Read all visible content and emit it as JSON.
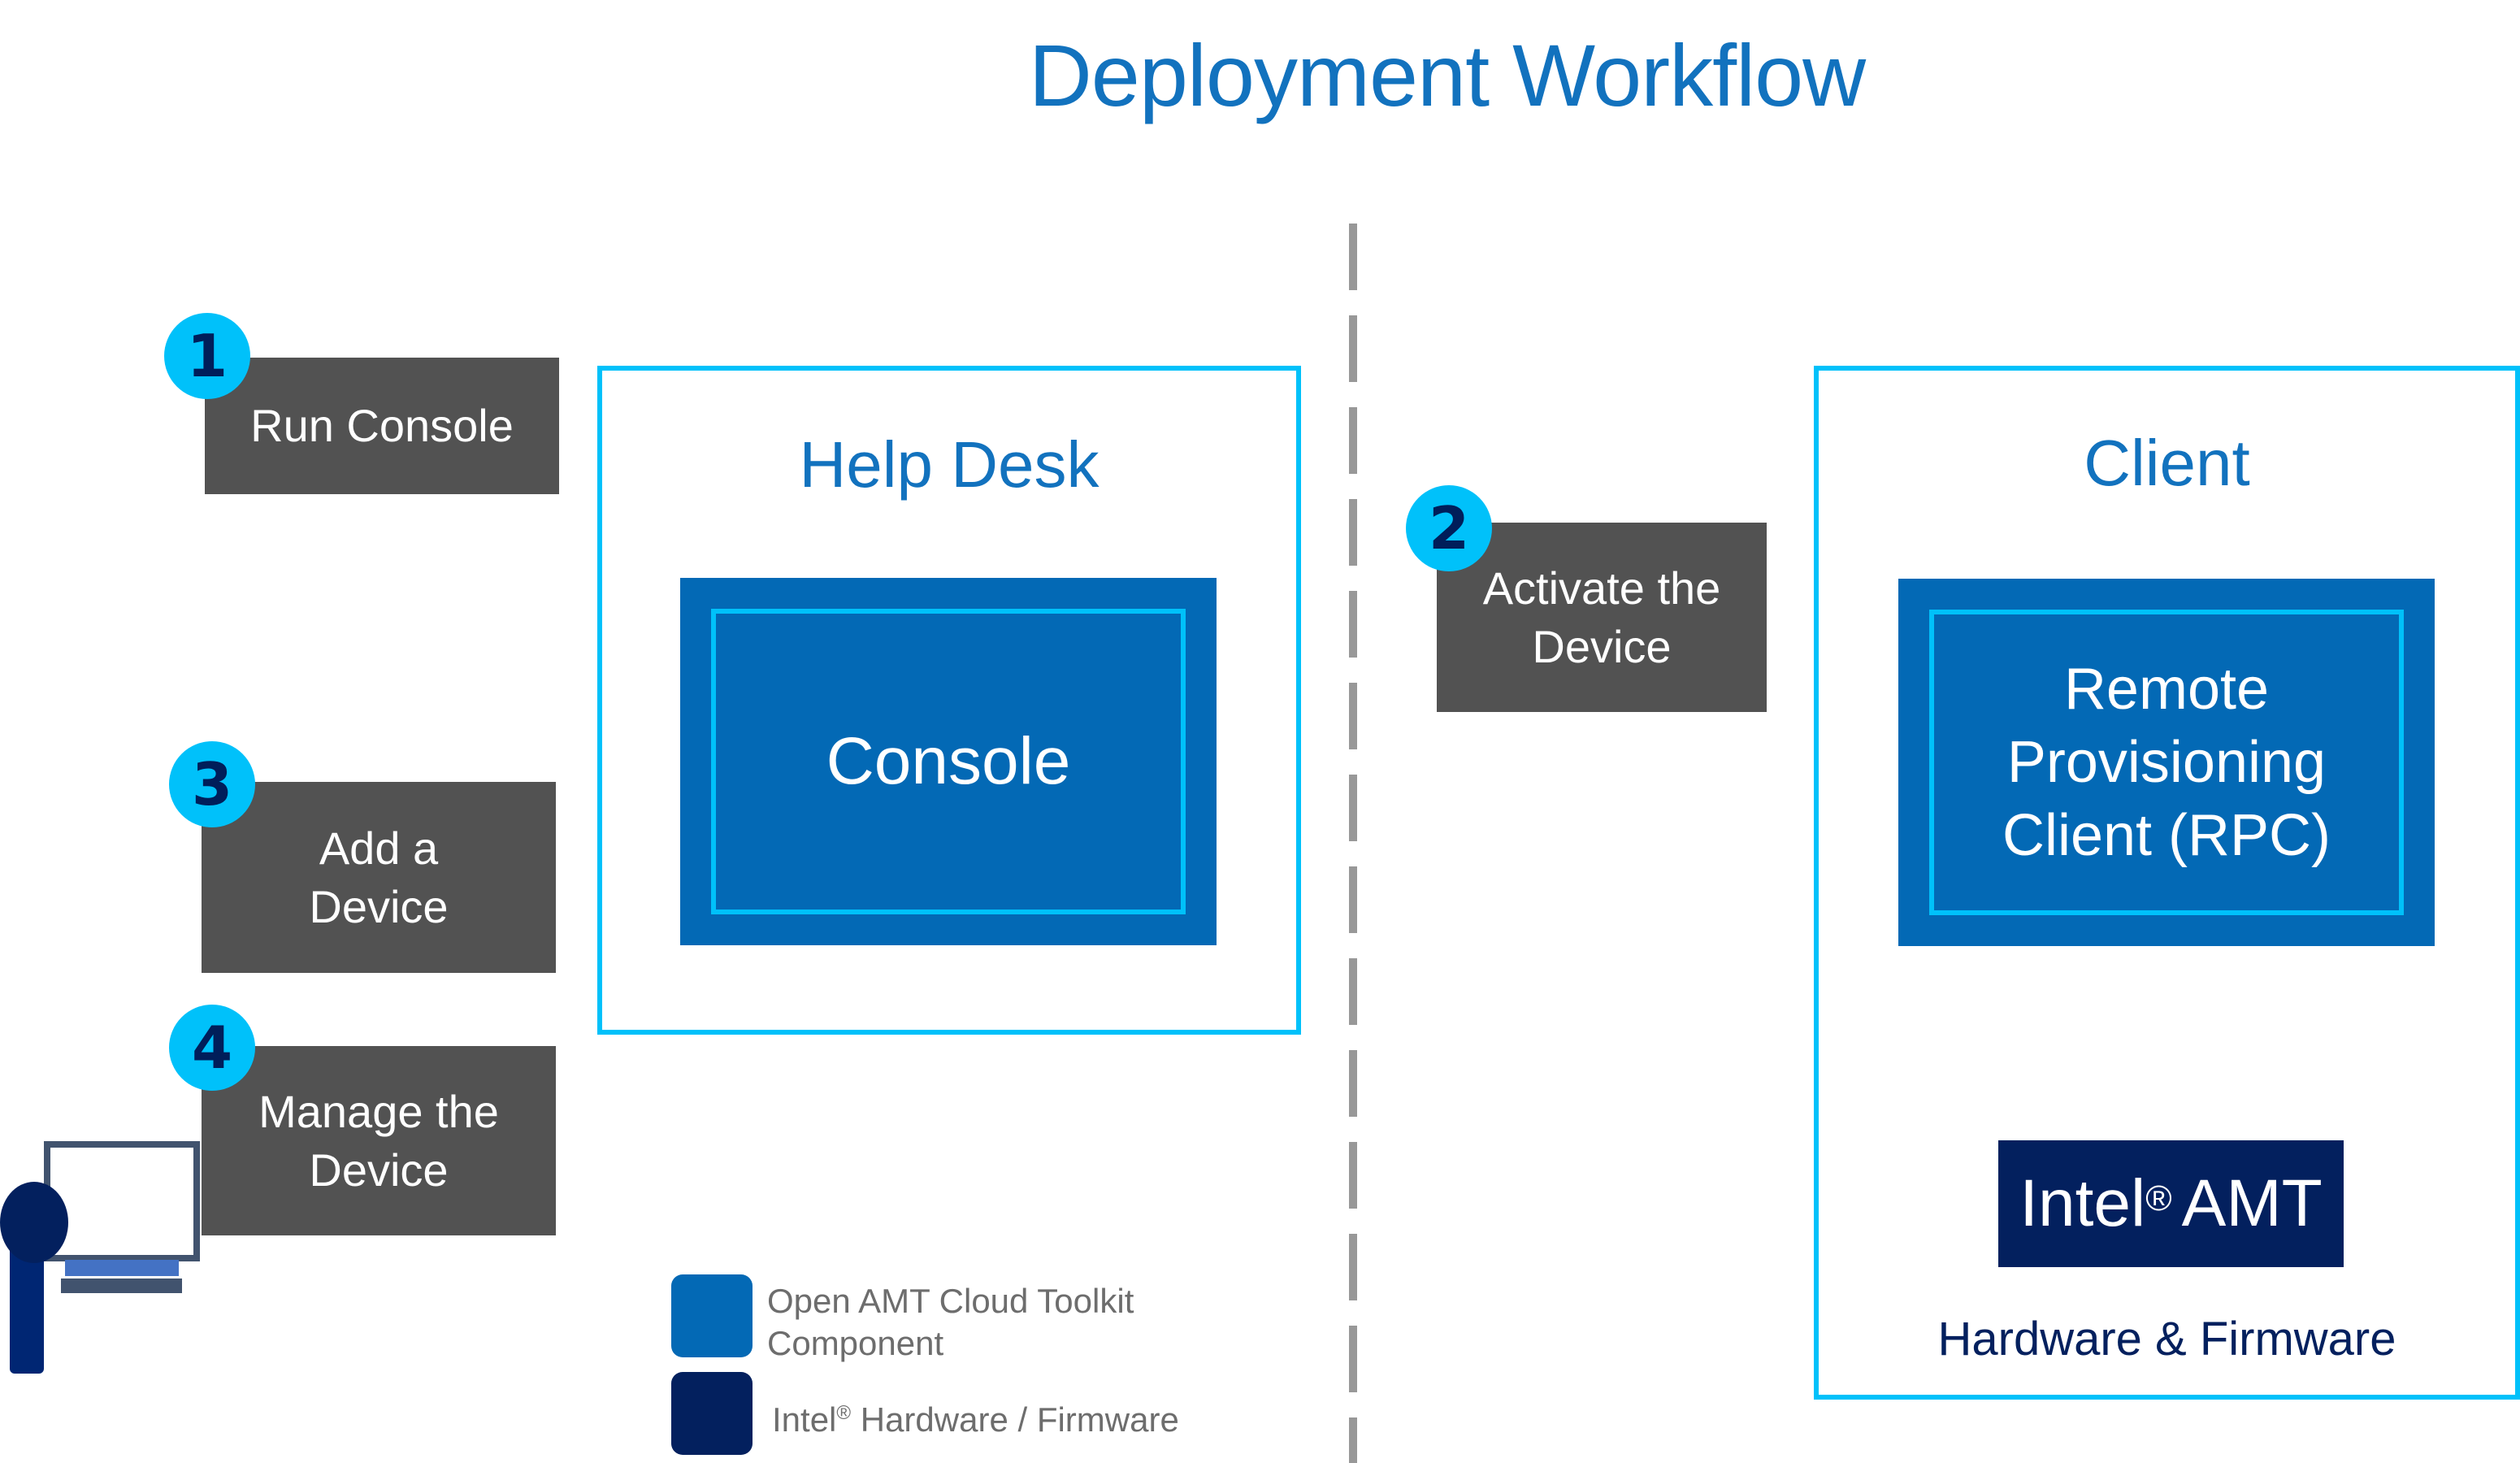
{
  "title": "Deployment Workflow",
  "colors": {
    "accent_blue": "#1272BE",
    "zone_border": "#00C1FA",
    "component_fill": "#0369B5",
    "hardware_fill": "#03205E",
    "step_fill": "#525252",
    "badge_fill": "#00C1FA",
    "badge_text": "#001E5A",
    "divider": "#989898"
  },
  "zones": {
    "help_desk": {
      "title": "Help Desk",
      "component": "Console"
    },
    "client": {
      "title": "Client",
      "component_lines": [
        "Remote",
        "Provisioning",
        "Client (RPC)"
      ],
      "hardware_name": "Intel",
      "hardware_mark": "®",
      "hardware_product": "AMT",
      "hardware_caption": "Hardware & Firmware"
    }
  },
  "steps": [
    {
      "number": "1",
      "lines": [
        "Run Console"
      ]
    },
    {
      "number": "2",
      "lines": [
        "Activate the",
        "Device"
      ]
    },
    {
      "number": "3",
      "lines": [
        "Add a",
        "Device"
      ]
    },
    {
      "number": "4",
      "lines": [
        "Manage the",
        "Device"
      ]
    }
  ],
  "legend": [
    {
      "color": "#0369B5",
      "lines": [
        "Open AMT Cloud Toolkit",
        "Component"
      ]
    },
    {
      "color": "#03205E",
      "prefix": "Intel",
      "mark": "®",
      "suffix": " Hardware / Firmware"
    }
  ],
  "icons": {
    "user": "user-at-computer-icon"
  }
}
